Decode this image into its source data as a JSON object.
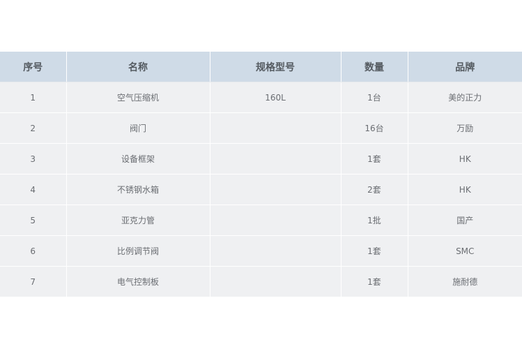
{
  "table": {
    "headers": [
      "序号",
      "名称",
      "规格型号",
      "数量",
      "品牌"
    ],
    "rows": [
      [
        "1",
        "空气压缩机",
        "160L",
        "1台",
        "美的正力"
      ],
      [
        "2",
        "阀门",
        "",
        "16台",
        "万励"
      ],
      [
        "3",
        "设备框架",
        "",
        "1套",
        "HK"
      ],
      [
        "4",
        "不锈钢水箱",
        "",
        "2套",
        "HK"
      ],
      [
        "5",
        "亚克力管",
        "",
        "1批",
        "国产"
      ],
      [
        "6",
        "比例调节阀",
        "",
        "1套",
        "SMC"
      ],
      [
        "7",
        "电气控制板",
        "",
        "1套",
        "施耐德"
      ]
    ]
  },
  "colors": {
    "header_bg": "#cfdbe7",
    "row_bg": "#eff0f2",
    "header_text": "#555b61",
    "cell_text": "#6a6d72"
  }
}
